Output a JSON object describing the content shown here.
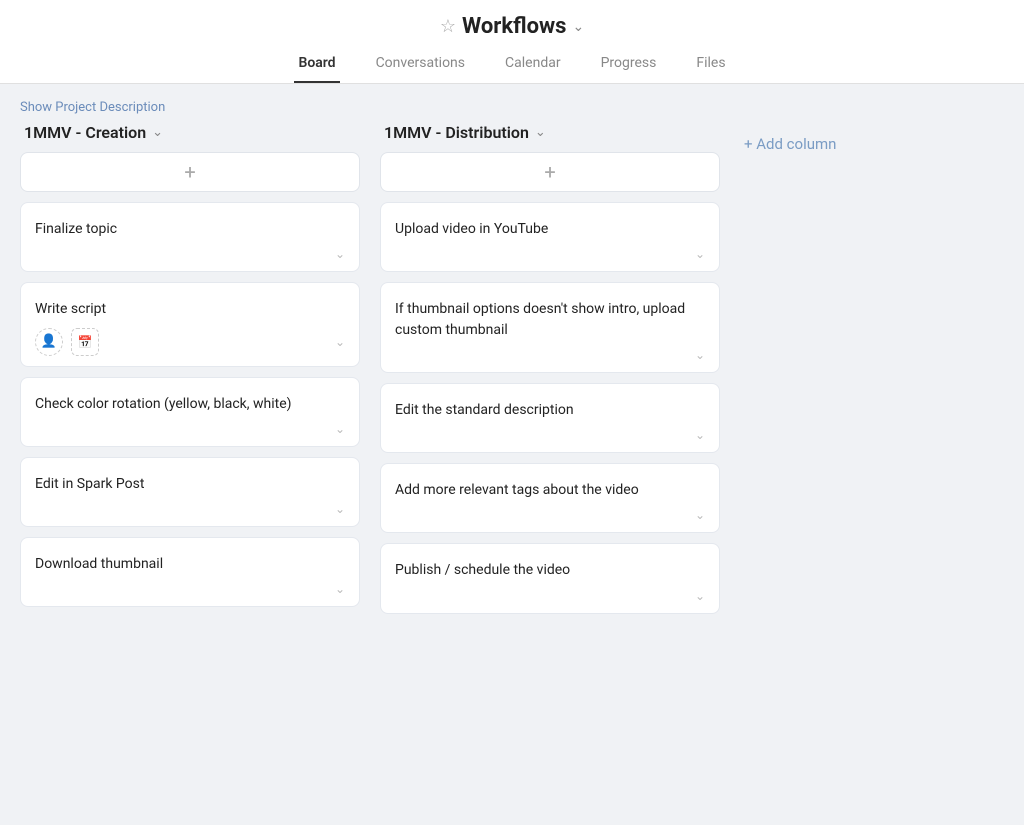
{
  "header": {
    "title": "Workflows",
    "star_icon": "☆",
    "chevron_icon": "⌄",
    "tabs": [
      {
        "label": "Board",
        "active": true
      },
      {
        "label": "Conversations",
        "active": false
      },
      {
        "label": "Calendar",
        "active": false
      },
      {
        "label": "Progress",
        "active": false
      },
      {
        "label": "Files",
        "active": false
      }
    ]
  },
  "subheader": {
    "show_project_desc": "Show Project Description"
  },
  "board": {
    "add_column_label": "+ Add column",
    "columns": [
      {
        "id": "creation",
        "title": "1MMV - Creation",
        "cards": [
          {
            "id": "c1",
            "title": "Finalize topic",
            "has_avatars": false
          },
          {
            "id": "c2",
            "title": "Write script",
            "has_avatars": true
          },
          {
            "id": "c3",
            "title": "Check color rotation (yellow, black, white)",
            "has_avatars": false
          },
          {
            "id": "c4",
            "title": "Edit in Spark Post",
            "has_avatars": false
          },
          {
            "id": "c5",
            "title": "Download thumbnail",
            "has_avatars": false
          }
        ]
      },
      {
        "id": "distribution",
        "title": "1MMV - Distribution",
        "cards": [
          {
            "id": "d1",
            "title": "Upload video in YouTube",
            "has_avatars": false
          },
          {
            "id": "d2",
            "title": "If thumbnail options doesn't show intro, upload custom thumbnail",
            "has_avatars": false
          },
          {
            "id": "d3",
            "title": "Edit the standard description",
            "has_avatars": false
          },
          {
            "id": "d4",
            "title": "Add more relevant tags about the video",
            "has_avatars": false
          },
          {
            "id": "d5",
            "title": "Publish / schedule the video",
            "has_avatars": false
          }
        ]
      }
    ]
  }
}
